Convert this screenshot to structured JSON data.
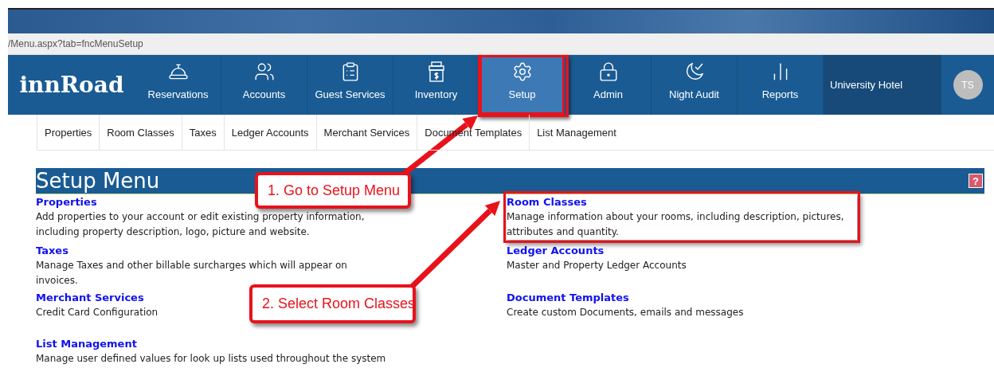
{
  "browser": {
    "url": "/Menu.aspx?tab=fncMenuSetup"
  },
  "nav": {
    "logo": "innRoad",
    "items": [
      {
        "label": "Reservations",
        "selected": false
      },
      {
        "label": "Accounts",
        "selected": false
      },
      {
        "label": "Guest Services",
        "selected": false
      },
      {
        "label": "Inventory",
        "selected": false
      },
      {
        "label": "Setup",
        "selected": true
      },
      {
        "label": "Admin",
        "selected": false
      },
      {
        "label": "Night Audit",
        "selected": false
      },
      {
        "label": "Reports",
        "selected": false
      }
    ],
    "property": "University Hotel",
    "avatar": "TS"
  },
  "subnav": [
    "Properties",
    "Room Classes",
    "Taxes",
    "Ledger Accounts",
    "Merchant Services",
    "Document Templates",
    "List Management"
  ],
  "setup_menu": {
    "title": "Setup Menu",
    "help": "?",
    "rows": [
      [
        {
          "title": "Properties",
          "description": "Add properties to your account or edit existing property information, including property description, logo, picture and website.",
          "highlighted": false
        },
        {
          "title": "Room Classes",
          "description": "Manage information about your rooms, including description, pictures, attributes and quantity.",
          "highlighted": true
        }
      ],
      [
        {
          "title": "Taxes",
          "description": "Manage Taxes and other billable surcharges which will appear on invoices.",
          "highlighted": false
        },
        {
          "title": "Ledger Accounts",
          "description": "Master and Property Ledger Accounts",
          "highlighted": false
        }
      ],
      [
        {
          "title": "Merchant Services",
          "description": "Credit Card Configuration",
          "highlighted": false
        },
        {
          "title": "Document Templates",
          "description": "Create custom Documents, emails and messages",
          "highlighted": false
        }
      ],
      [
        {
          "title": "List Management",
          "description": "Manage user defined values for look up lists used throughout the system",
          "highlighted": false
        }
      ]
    ]
  },
  "annotations": [
    {
      "text": "1. Go to Setup Menu"
    },
    {
      "text": "2. Select Room Classes"
    }
  ]
}
